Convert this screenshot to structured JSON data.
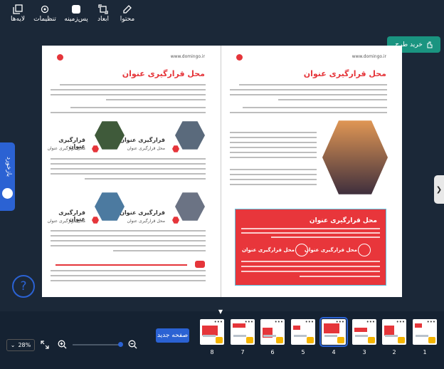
{
  "toolbar": {
    "content": "محتوا",
    "dimensions": "ابعاد",
    "background": "پس‌زمینه",
    "settings": "تنظیمات",
    "layers": "لایه‌ها",
    "icons": [
      "edit-icon",
      "resize-icon",
      "background-icon",
      "settings-icon",
      "layers-icon"
    ]
  },
  "buy_button": "خرید طرح",
  "side_tab": "بازخورد",
  "help_label": "?",
  "arrow_right": "❯",
  "page_left": {
    "site": "www.domingo.ir",
    "title": "محل قرارگیری عنوان",
    "items": [
      {
        "title": "قرارگیری عنوان",
        "subtitle": "محل قرارگیری عنوان"
      },
      {
        "title": "قرارگیری عنوان",
        "subtitle": "محل قرارگیری عنوان"
      },
      {
        "title": "قرارگیری عنوان",
        "subtitle": "محل قرارگیری عنوان"
      },
      {
        "title": "قرارگیری عنوان",
        "subtitle": "محل قرارگیری عنوان"
      }
    ]
  },
  "page_right": {
    "site": "www.domingo.ir",
    "title": "محل قرارگیری عنوان",
    "box_title": "محل قرارگیری عنوان",
    "box_items": [
      "محل قرارگیری عنوان",
      "محل قرارگیری عنوان"
    ]
  },
  "bottom": {
    "zoom": "28%",
    "new_page": "صفحه جدید",
    "collapse": "▼",
    "pages": [
      "1",
      "2",
      "3",
      "4",
      "5",
      "6",
      "7",
      "8"
    ],
    "selected_page": "4"
  },
  "colors": {
    "accent": "#2b62d3",
    "brand_red": "#e5353a",
    "buy": "#1a9480",
    "bg": "#1b2838"
  }
}
